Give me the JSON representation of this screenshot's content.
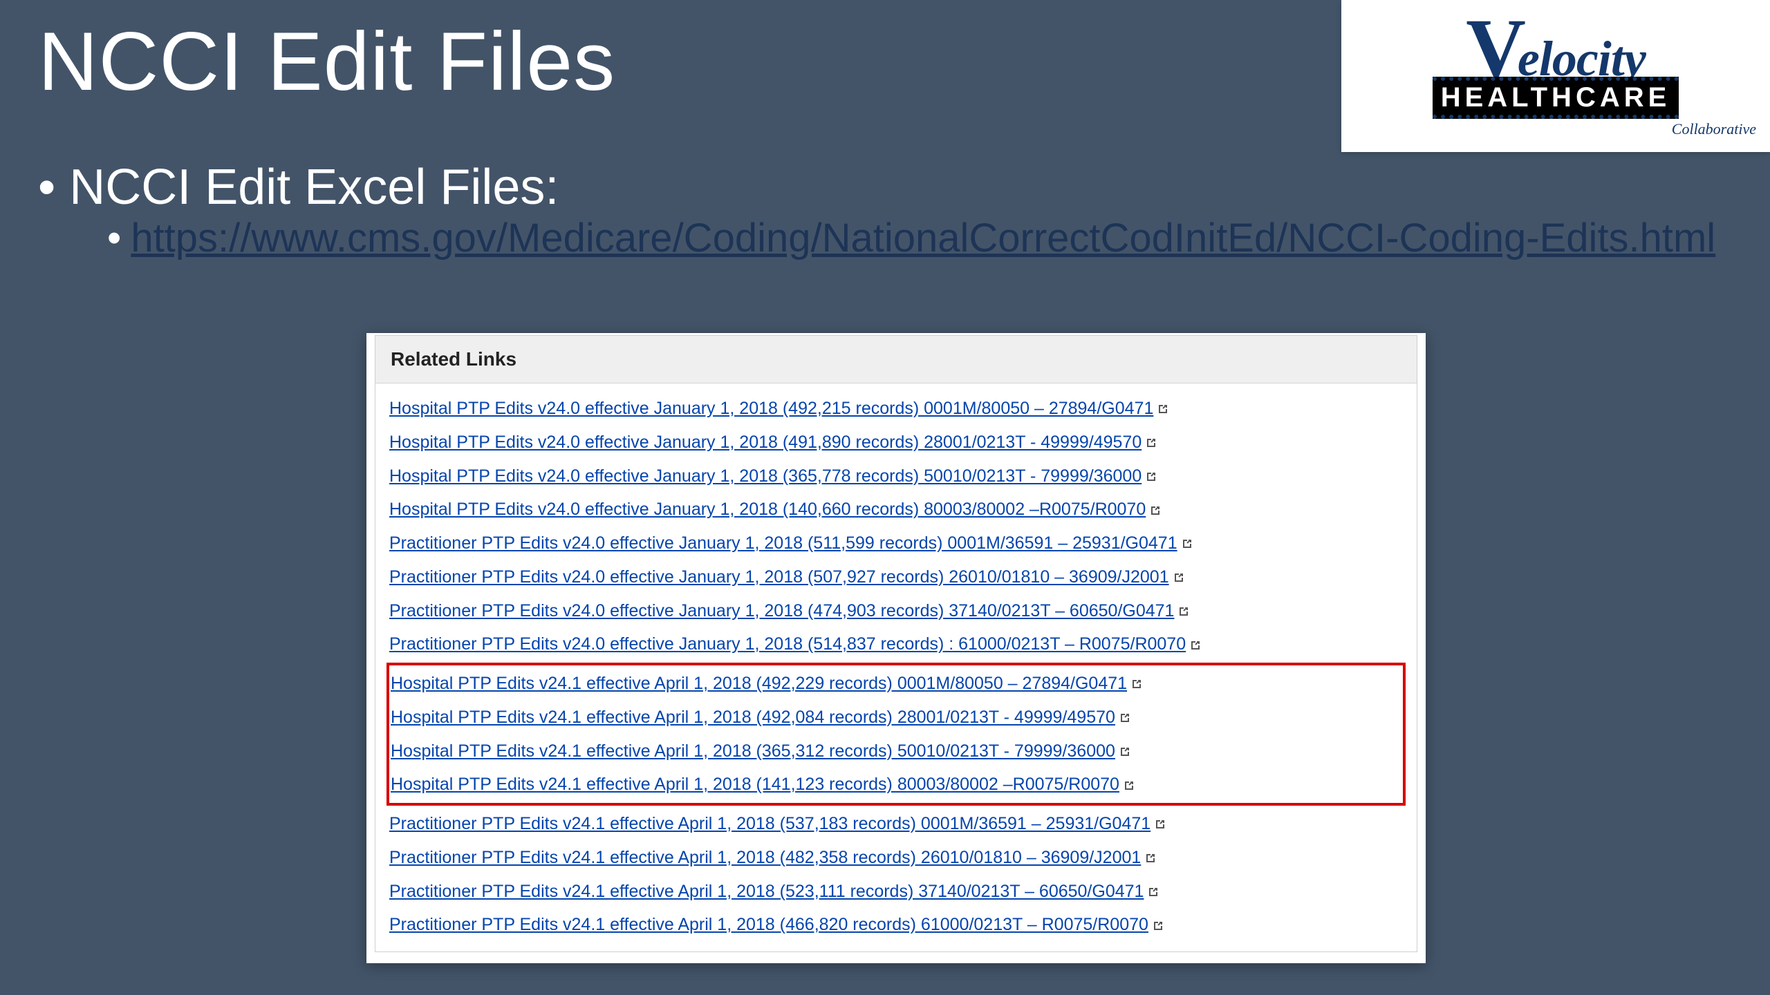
{
  "title": "NCCI Edit Files",
  "logo": {
    "line1_v": "V",
    "line1_rest": "elocity",
    "line2": "HEALTHCARE",
    "sub": "Collaborative"
  },
  "bullet_label": "NCCI Edit Excel Files:",
  "bullet_url": "https://www.cms.gov/Medicare/Coding/NationalCorrectCodInitEd/NCCI-Coding-Edits.html",
  "panel_header": "Related Links",
  "links": [
    {
      "text": "Hospital PTP Edits v24.0 effective January 1, 2018 (492,215 records) 0001M/80050 – 27894/G0471",
      "hl": false
    },
    {
      "text": "Hospital PTP Edits v24.0 effective January 1, 2018 (491,890 records) 28001/0213T - 49999/49570",
      "hl": false
    },
    {
      "text": "Hospital PTP Edits v24.0 effective January 1, 2018 (365,778 records) 50010/0213T - 79999/36000",
      "hl": false
    },
    {
      "text": "Hospital PTP Edits v24.0 effective January 1, 2018 (140,660 records) 80003/80002 –R0075/R0070",
      "hl": false
    },
    {
      "text": "Practitioner PTP Edits v24.0 effective January 1, 2018 (511,599 records) 0001M/36591 – 25931/G0471",
      "hl": false
    },
    {
      "text": "Practitioner PTP Edits v24.0 effective January 1, 2018 (507,927 records) 26010/01810 – 36909/J2001",
      "hl": false
    },
    {
      "text": "Practitioner PTP Edits v24.0 effective January 1, 2018 (474,903 records) 37140/0213T – 60650/G0471",
      "hl": false
    },
    {
      "text": "Practitioner PTP Edits v24.0 effective January 1, 2018 (514,837 records) : 61000/0213T – R0075/R0070",
      "hl": false
    },
    {
      "text": "Hospital PTP Edits v24.1 effective April 1, 2018 (492,229 records) 0001M/80050 – 27894/G0471",
      "hl": true
    },
    {
      "text": "Hospital PTP Edits v24.1 effective April 1, 2018 (492,084 records) 28001/0213T - 49999/49570",
      "hl": true
    },
    {
      "text": "Hospital PTP Edits v24.1 effective April 1, 2018 (365,312 records) 50010/0213T - 79999/36000",
      "hl": true
    },
    {
      "text": "Hospital PTP Edits v24.1 effective April 1, 2018 (141,123 records) 80003/80002 –R0075/R0070",
      "hl": true
    },
    {
      "text": "Practitioner PTP Edits v24.1 effective April 1, 2018 (537,183 records) 0001M/36591 – 25931/G0471",
      "hl": false
    },
    {
      "text": "Practitioner PTP Edits v24.1 effective April 1, 2018 (482,358 records) 26010/01810 – 36909/J2001",
      "hl": false
    },
    {
      "text": "Practitioner PTP Edits v24.1 effective April 1, 2018 (523,111 records) 37140/0213T – 60650/G0471",
      "hl": false
    },
    {
      "text": "Practitioner PTP Edits v24.1 effective April 1, 2018 (466,820 records) 61000/0213T – R0075/R0070",
      "hl": false
    }
  ]
}
